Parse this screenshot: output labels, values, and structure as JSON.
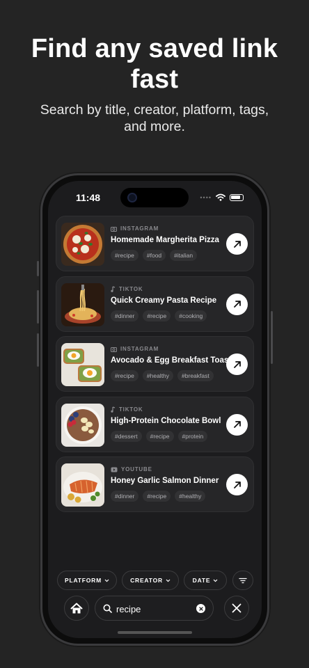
{
  "marketing": {
    "headline_line1": "Find any saved link",
    "headline_line2": "fast",
    "subhead_line1": "Search by title, creator, platform, tags,",
    "subhead_line2": "and more."
  },
  "status_bar": {
    "time": "11:48"
  },
  "results": [
    {
      "platform": "INSTAGRAM",
      "platform_icon": "camera-icon",
      "title": "Homemade Margherita Pizza",
      "tags": [
        "#recipe",
        "#food",
        "#italian"
      ]
    },
    {
      "platform": "TIKTOK",
      "platform_icon": "music-note-icon",
      "title": "Quick Creamy Pasta Recipe",
      "tags": [
        "#dinner",
        "#recipe",
        "#cooking"
      ]
    },
    {
      "platform": "INSTAGRAM",
      "platform_icon": "camera-icon",
      "title": "Avocado & Egg Breakfast Toast",
      "tags": [
        "#recipe",
        "#healthy",
        "#breakfast"
      ]
    },
    {
      "platform": "TIKTOK",
      "platform_icon": "music-note-icon",
      "title": "High-Protein Chocolate Bowl",
      "tags": [
        "#dessert",
        "#recipe",
        "#protein"
      ]
    },
    {
      "platform": "YOUTUBE",
      "platform_icon": "youtube-icon",
      "title": "Honey Garlic Salmon Dinner",
      "tags": [
        "#dinner",
        "#recipe",
        "#healthy"
      ]
    }
  ],
  "filters": {
    "platform": "PLATFORM",
    "creator": "CREATOR",
    "date": "DATE"
  },
  "search": {
    "value": "recipe"
  },
  "colors": {
    "background": "#242424",
    "screen": "#1c1c1e",
    "card": "#262628"
  }
}
